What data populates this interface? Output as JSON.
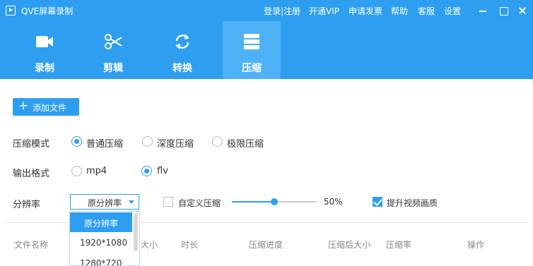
{
  "titlebar": {
    "title": "QVE屏幕录制",
    "links": {
      "login": "登录|注册",
      "vip": "开通VIP",
      "invoice": "申请发票",
      "help": "帮助",
      "service": "客服",
      "settings": "设置"
    }
  },
  "toolbar": {
    "record": "录制",
    "cut": "剪辑",
    "convert": "转换",
    "compress": "压缩"
  },
  "content": {
    "add_file": "添加文件",
    "compress_mode": {
      "label": "压缩模式",
      "options": [
        "普通压缩",
        "深度压缩",
        "极限压缩"
      ],
      "selected": "普通压缩"
    },
    "output_format": {
      "label": "输出格式",
      "options": [
        "mp4",
        "flv"
      ],
      "selected": "flv"
    },
    "resolution": {
      "label": "分辨率",
      "value": "原分辨率",
      "options": [
        "原分辨率",
        "1920*1080",
        "1280*720"
      ]
    },
    "custom_compress": {
      "label": "自定义压缩",
      "checked": false,
      "value_text": "50%",
      "fraction": 0.5
    },
    "enhance_quality": {
      "label": "提升视频画质",
      "checked": true
    },
    "columns": [
      "文件名称",
      "大小",
      "时长",
      "压缩进度",
      "压缩后大小",
      "压缩率",
      "操作"
    ]
  },
  "colors": {
    "accent": "#2e9ff0",
    "active_tab": "#4fb1f5"
  },
  "icons": {
    "app": "play-box-icon",
    "record": "video-camera-icon",
    "cut": "scissors-icon",
    "convert": "refresh-icon",
    "compress": "stack-icon"
  }
}
